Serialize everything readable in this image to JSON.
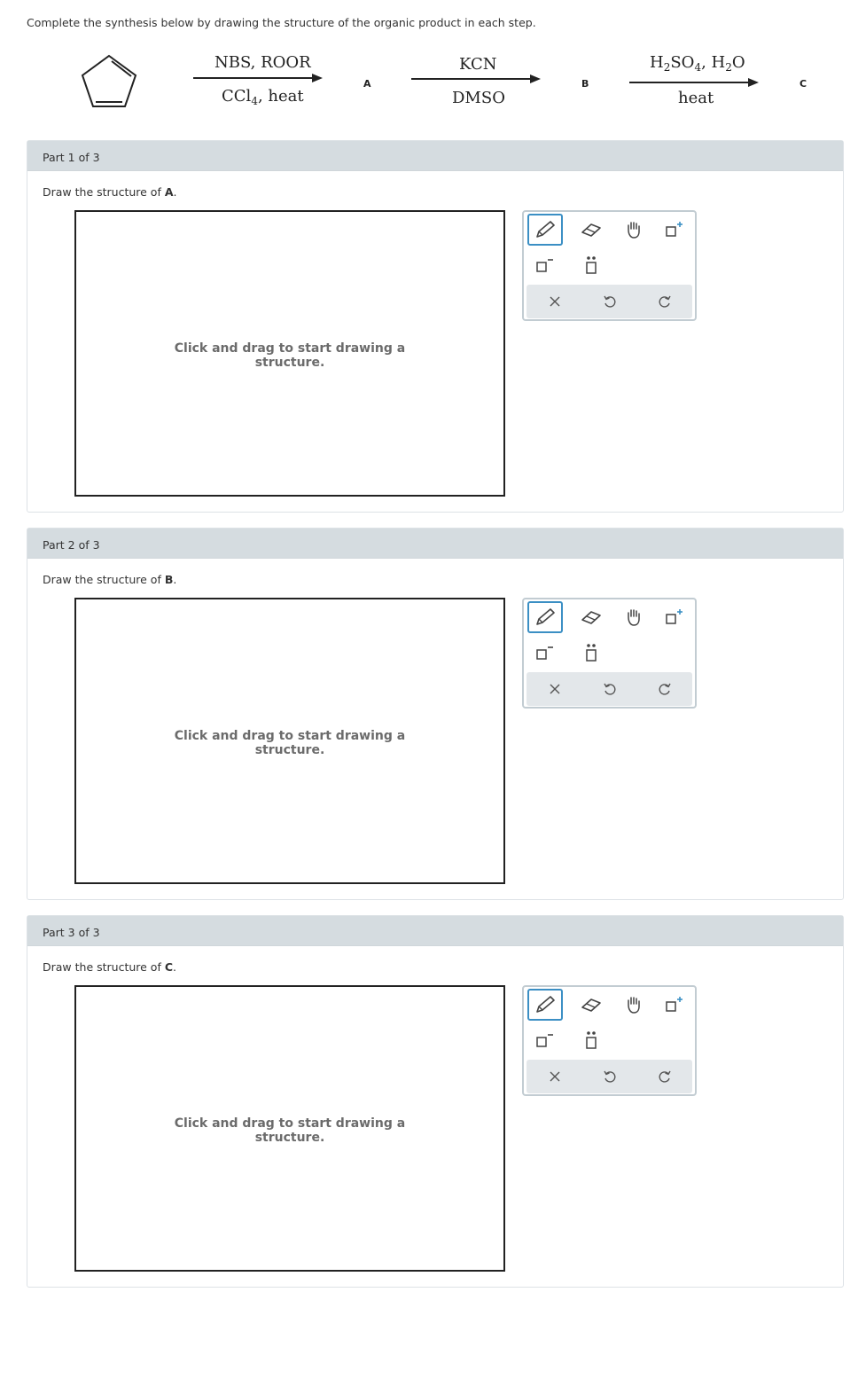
{
  "instructions": "Complete the synthesis below by drawing the structure of the organic product in each step.",
  "scheme": {
    "step1": {
      "above": "NBS, ROOR",
      "below_main": "CCl",
      "below_sub": "4",
      "below_rest": ", heat",
      "product": "A"
    },
    "step2": {
      "above": "KCN",
      "below": "DMSO",
      "product": "B"
    },
    "step3": {
      "above_h": "H",
      "above_sub1": "2",
      "above_so": "SO",
      "above_sub2": "4",
      "above_comma": ", H",
      "above_sub3": "2",
      "above_o": "O",
      "below": "heat",
      "product": "C"
    }
  },
  "parts": [
    {
      "header": "Part 1 of 3",
      "prompt_prefix": "Draw the structure of ",
      "prompt_letter": "A",
      "prompt_suffix": ".",
      "hint_line1": "Click and drag to start drawing a",
      "hint_line2": "structure."
    },
    {
      "header": "Part 2 of 3",
      "prompt_prefix": "Draw the structure of ",
      "prompt_letter": "B",
      "prompt_suffix": ".",
      "hint_line1": "Click and drag to start drawing a",
      "hint_line2": "structure."
    },
    {
      "header": "Part 3 of 3",
      "prompt_prefix": "Draw the structure of ",
      "prompt_letter": "C",
      "prompt_suffix": ".",
      "hint_line1": "Click and drag to start drawing a",
      "hint_line2": "structure."
    }
  ],
  "toolbar": {
    "tools": [
      "pencil-icon",
      "eraser-icon",
      "hand-icon",
      "add-charge-icon",
      "subtract-charge-icon",
      "lone-pair-icon",
      "clear-icon",
      "undo-icon",
      "redo-icon"
    ]
  },
  "colors": {
    "accent": "#3b8fc4",
    "header_bg": "#d5dce0",
    "border": "#dde2e6"
  }
}
